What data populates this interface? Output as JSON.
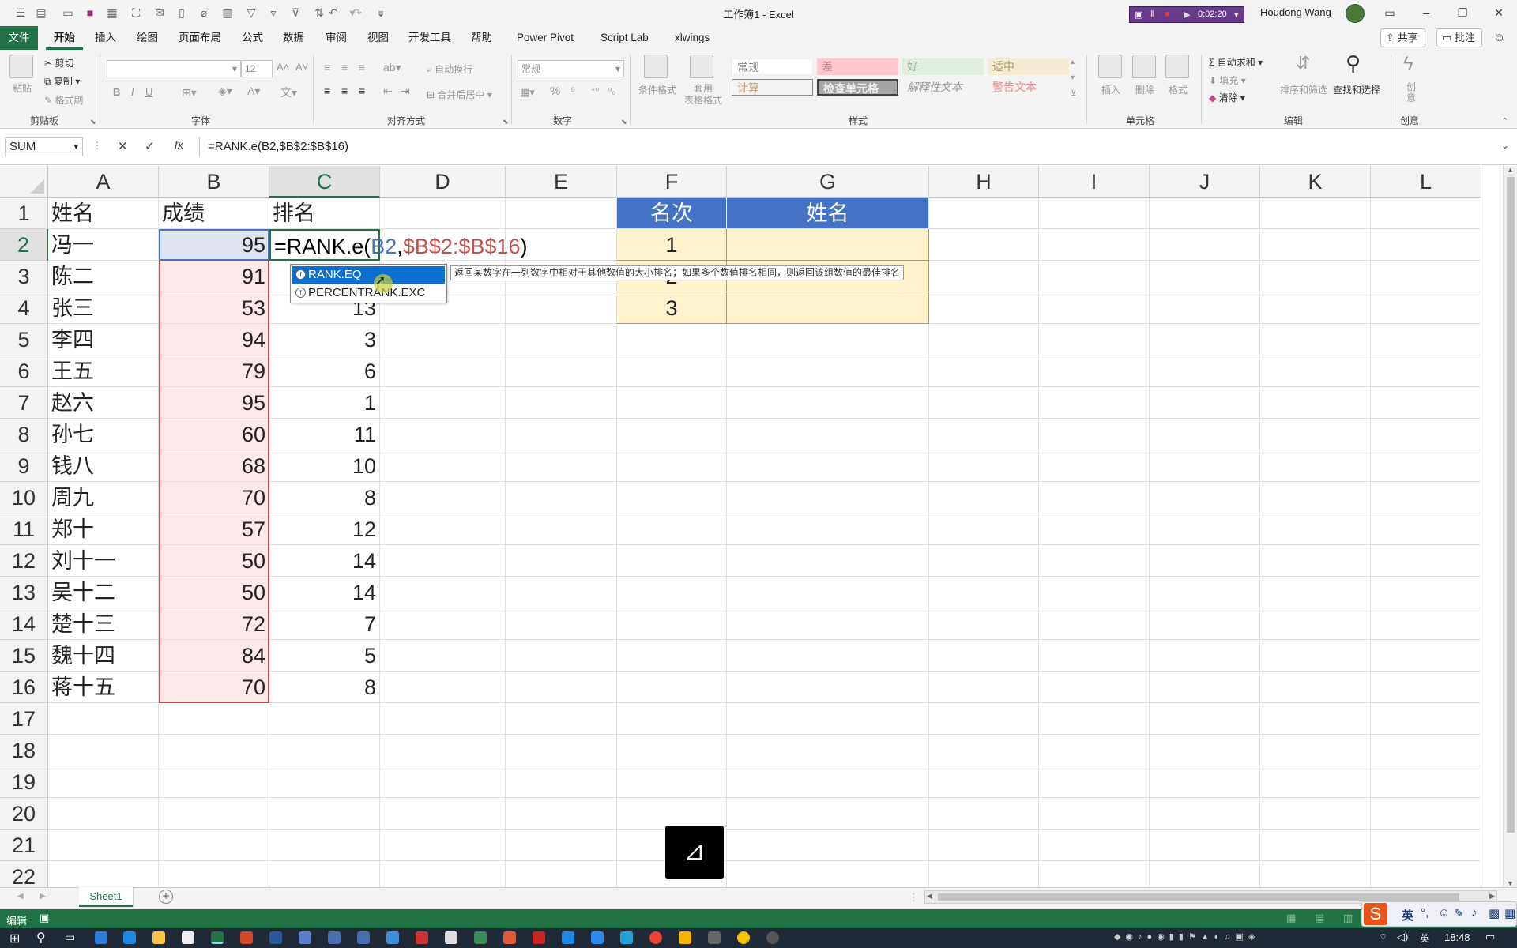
{
  "window": {
    "title": "工作簿1  -  Excel",
    "recorder_time": "0:02:20",
    "user_name": "Houdong Wang"
  },
  "menu": {
    "file": "文件",
    "tabs": [
      "开始",
      "插入",
      "绘图",
      "页面布局",
      "公式",
      "数据",
      "审阅",
      "视图",
      "开发工具",
      "帮助",
      "Power Pivot",
      "Script Lab",
      "xlwings"
    ],
    "share": "共享",
    "comment": "批注"
  },
  "ribbon": {
    "clipboard": {
      "paste": "粘贴",
      "cut": "剪切",
      "copy": "复制",
      "format_painter": "格式刷",
      "label": "剪贴板"
    },
    "font": {
      "size": "12",
      "bold": "B",
      "italic": "I",
      "underline": "U",
      "label": "字体"
    },
    "alignment": {
      "wrap": "自动换行",
      "merge": "合并后居中",
      "label": "对齐方式"
    },
    "number": {
      "format": "常规",
      "label": "数字"
    },
    "styles": {
      "conditional": "条件格式",
      "table": "套用\n表格格式",
      "cells": [
        "常规",
        "差",
        "好",
        "适中",
        "计算",
        "检查单元格",
        "解释性文本",
        "警告文本"
      ],
      "label": "样式"
    },
    "cells": {
      "insert": "插入",
      "delete": "删除",
      "format": "格式",
      "label": "单元格"
    },
    "editing": {
      "autosum": "自动求和",
      "fill": "填充",
      "clear": "清除",
      "sort": "排序和筛选",
      "find": "查找和选择",
      "label": "编辑"
    },
    "creativity": {
      "create": "创\n意",
      "label": "创意"
    },
    "colors": {
      "accent": "#217346",
      "bad_bg": "#ffc7ce",
      "good_bg": "#c6efce",
      "neutral_bg": "#ffeb9c"
    }
  },
  "formula_bar": {
    "name_box": "SUM",
    "cancel": "✕",
    "enter": "✓",
    "fx": "fx",
    "formula": "=RANK.e(B2,$B$2:$B$16)"
  },
  "grid": {
    "columns": [
      "A",
      "B",
      "C",
      "D",
      "E",
      "F",
      "G",
      "H",
      "I",
      "J",
      "K",
      "L"
    ],
    "rows": [
      "1",
      "2",
      "3",
      "4",
      "5",
      "6",
      "7",
      "8",
      "9",
      "10",
      "11",
      "12",
      "13",
      "14",
      "15",
      "16",
      "17",
      "18",
      "19",
      "20",
      "21",
      "22"
    ],
    "headers": {
      "name": "姓名",
      "score": "成绩",
      "rank": "排名"
    },
    "names": [
      "冯一",
      "陈二",
      "张三",
      "李四",
      "王五",
      "赵六",
      "孙七",
      "钱八",
      "周九",
      "郑十",
      "刘十一",
      "吴十二",
      "楚十三",
      "魏十四",
      "蒋十五"
    ],
    "scores": [
      "95",
      "91",
      "53",
      "94",
      "79",
      "95",
      "60",
      "68",
      "70",
      "57",
      "50",
      "50",
      "72",
      "84",
      "70"
    ],
    "ranks": [
      "",
      "",
      "13",
      "3",
      "6",
      "1",
      "11",
      "10",
      "8",
      "12",
      "14",
      "14",
      "7",
      "5",
      "8"
    ],
    "editing_cell": {
      "prefix": "=RANK.e(",
      "ref1": "B2",
      "comma": ",",
      "ref2": "$B$2:$B$16",
      "suffix": ")"
    },
    "lookup_table": {
      "header_rank": "名次",
      "header_name": "姓名",
      "rank_values": [
        "1",
        "2",
        "3"
      ],
      "header_bg": "#4472c4",
      "cell_bg": "#fff2cc"
    }
  },
  "autocomplete": {
    "items": [
      "RANK.EQ",
      "PERCENTRANK.EXC"
    ],
    "tooltip": "返回某数字在一列数字中相对于其他数值的大小排名；如果多个数值排名相同，则返回该组数值的最佳排名"
  },
  "sheets": {
    "tabs": [
      "Sheet1"
    ],
    "add": "+"
  },
  "status": {
    "mode": "编辑"
  },
  "ime": {
    "lang": "英"
  },
  "taskbar": {
    "time": "18:48"
  }
}
